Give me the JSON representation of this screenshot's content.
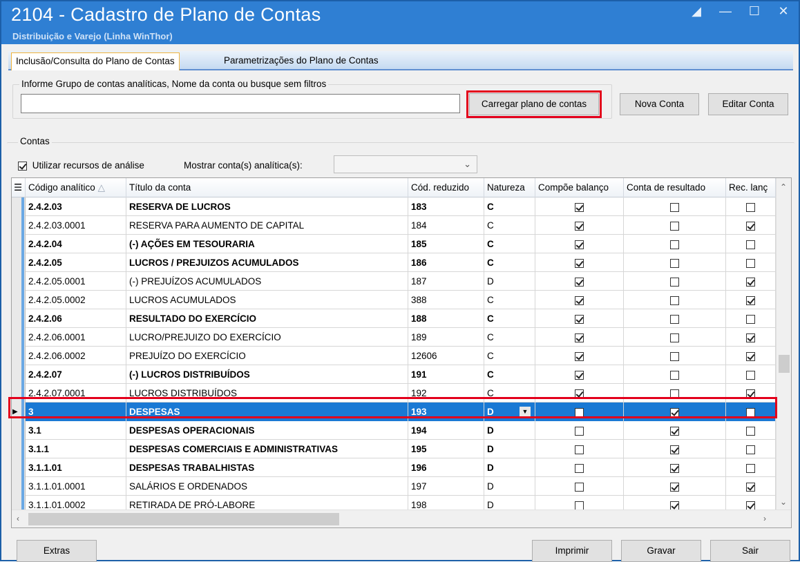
{
  "window": {
    "title": "2104 - Cadastro de Plano de Contas",
    "subtitle": "Distribuição e Varejo (Linha WinThor)",
    "controls": [
      "restore-icon",
      "minimize-icon",
      "maximize-icon",
      "close-icon"
    ]
  },
  "tabs": [
    {
      "label": "Inclusão/Consulta do Plano de Contas",
      "active": true
    },
    {
      "label": "Parametrizações do Plano de Contas",
      "active": false
    }
  ],
  "search": {
    "group_label": "Informe Grupo de contas analíticas, Nome da conta ou busque sem filtros",
    "value": "",
    "load_button": "Carregar plano de contas"
  },
  "actions": {
    "new_account": "Nova Conta",
    "edit_account": "Editar Conta"
  },
  "accounts": {
    "group_label": "Contas",
    "use_analysis_label": "Utilizar recursos de análise",
    "use_analysis_checked": true,
    "show_analytic_label": "Mostrar conta(s) analítica(s):",
    "show_analytic_value": ""
  },
  "grid": {
    "columns": [
      "Código analítico",
      "Título da conta",
      "Cód. reduzido",
      "Natureza",
      "Compõe balanço",
      "Conta de resultado",
      "Rec. lanç"
    ],
    "rows": [
      {
        "code": "2.4.2.03",
        "title": "RESERVA DE LUCROS",
        "reduced": "183",
        "nature": "C",
        "balance": true,
        "result": false,
        "rec": false,
        "bold": true
      },
      {
        "code": "2.4.2.03.0001",
        "title": "RESERVA PARA AUMENTO DE CAPITAL",
        "reduced": "184",
        "nature": "C",
        "balance": true,
        "result": false,
        "rec": true,
        "bold": false
      },
      {
        "code": "2.4.2.04",
        "title": "(-) AÇÕES EM TESOURARIA",
        "reduced": "185",
        "nature": "C",
        "balance": true,
        "result": false,
        "rec": false,
        "bold": true
      },
      {
        "code": "2.4.2.05",
        "title": "LUCROS / PREJUIZOS ACUMULADOS",
        "reduced": "186",
        "nature": "C",
        "balance": true,
        "result": false,
        "rec": false,
        "bold": true
      },
      {
        "code": "2.4.2.05.0001",
        "title": "(-) PREJUÍZOS ACUMULADOS",
        "reduced": "187",
        "nature": "D",
        "balance": true,
        "result": false,
        "rec": true,
        "bold": false
      },
      {
        "code": "2.4.2.05.0002",
        "title": "LUCROS ACUMULADOS",
        "reduced": "388",
        "nature": "C",
        "balance": true,
        "result": false,
        "rec": true,
        "bold": false
      },
      {
        "code": "2.4.2.06",
        "title": "RESULTADO DO EXERCÍCIO",
        "reduced": "188",
        "nature": "C",
        "balance": true,
        "result": false,
        "rec": false,
        "bold": true
      },
      {
        "code": "2.4.2.06.0001",
        "title": "LUCRO/PREJUIZO DO EXERCÍCIO",
        "reduced": "189",
        "nature": "C",
        "balance": true,
        "result": false,
        "rec": true,
        "bold": false
      },
      {
        "code": "2.4.2.06.0002",
        "title": "PREJUÍZO DO EXERCÍCIO",
        "reduced": "12606",
        "nature": "C",
        "balance": true,
        "result": false,
        "rec": true,
        "bold": false
      },
      {
        "code": "2.4.2.07",
        "title": "(-) LUCROS DISTRIBUÍDOS",
        "reduced": "191",
        "nature": "C",
        "balance": true,
        "result": false,
        "rec": false,
        "bold": true
      },
      {
        "code": "2.4.2.07.0001",
        "title": "LUCROS DISTRIBUÍDOS",
        "reduced": "192",
        "nature": "C",
        "balance": true,
        "result": false,
        "rec": true,
        "bold": false
      },
      {
        "code": "3",
        "title": "DESPESAS",
        "reduced": "193",
        "nature": "D",
        "balance": false,
        "result": true,
        "rec": false,
        "bold": true,
        "selected": true
      },
      {
        "code": "3.1",
        "title": "DESPESAS OPERACIONAIS",
        "reduced": "194",
        "nature": "D",
        "balance": false,
        "result": true,
        "rec": false,
        "bold": true
      },
      {
        "code": "3.1.1",
        "title": "DESPESAS COMERCIAIS E ADMINISTRATIVAS",
        "reduced": "195",
        "nature": "D",
        "balance": false,
        "result": true,
        "rec": false,
        "bold": true
      },
      {
        "code": "3.1.1.01",
        "title": "DESPESAS TRABALHISTAS",
        "reduced": "196",
        "nature": "D",
        "balance": false,
        "result": true,
        "rec": false,
        "bold": true
      },
      {
        "code": "3.1.1.01.0001",
        "title": "SALÁRIOS E ORDENADOS",
        "reduced": "197",
        "nature": "D",
        "balance": false,
        "result": true,
        "rec": true,
        "bold": false
      },
      {
        "code": "3.1.1.01.0002",
        "title": "RETIRADA DE PRÓ-LABORE",
        "reduced": "198",
        "nature": "D",
        "balance": false,
        "result": true,
        "rec": true,
        "bold": false
      }
    ]
  },
  "footer": {
    "extras": "Extras",
    "print": "Imprimir",
    "save": "Gravar",
    "exit": "Sair"
  },
  "colors": {
    "titlebar": "#2f7fd3",
    "selection": "#1a79d4",
    "highlight": "#e3001b"
  }
}
